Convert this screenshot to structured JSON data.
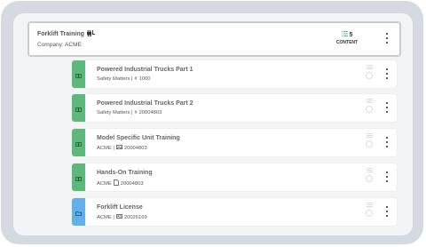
{
  "header": {
    "title": "Forklift Training",
    "company": "Company: ACME",
    "content_count": "5",
    "content_label": "CONTENT"
  },
  "items": [
    {
      "title": "Powered Industrial Trucks Part 1",
      "sub_prefix": "Safety Matters |",
      "sub_icon": "hash-icon",
      "sub_code": "1000",
      "tile": "green",
      "tile_icon": "book-icon"
    },
    {
      "title": "Powered Industrial Trucks Part 2",
      "sub_prefix": "Safety Matters |",
      "sub_icon": "hash-icon",
      "sub_code": "20004803",
      "tile": "green",
      "tile_icon": "book-icon"
    },
    {
      "title": "Model Specific Unit Training",
      "sub_prefix": "ACME |",
      "sub_icon": "image-icon",
      "sub_code": "20004803",
      "tile": "green",
      "tile_icon": "book-icon"
    },
    {
      "title": "Hands-On Training",
      "sub_prefix": "ACME",
      "sub_icon": "document-icon",
      "sub_code": "20004803",
      "tile": "green",
      "tile_icon": "book-icon"
    },
    {
      "title": "Forklift License",
      "sub_prefix": "ACME |",
      "sub_icon": "id-card-icon",
      "sub_code": "20026169",
      "tile": "blue",
      "tile_icon": "folder-icon"
    }
  ],
  "colors": {
    "green_tile": "#5cb97b",
    "blue_tile": "#61b0ee",
    "frame": "#d4d9e2",
    "panel": "#f3f4f6"
  }
}
